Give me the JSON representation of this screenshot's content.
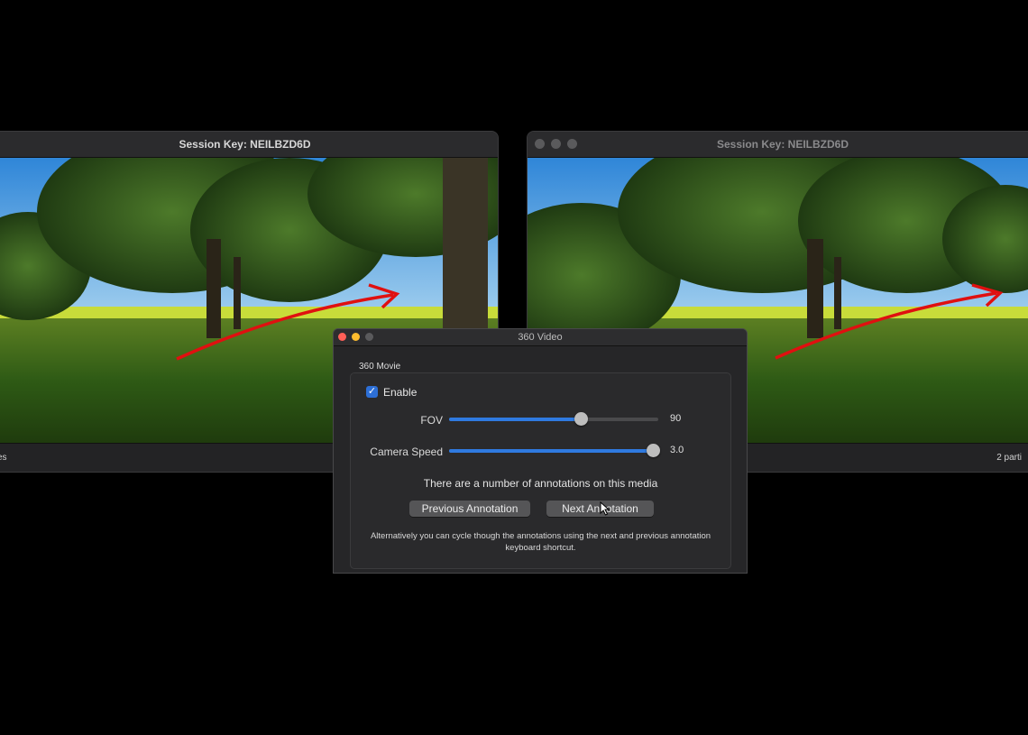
{
  "left_window": {
    "title": "Session Key: NEILBZD6D",
    "status_text": "es"
  },
  "right_window": {
    "title": "Session Key: NEILBZD6D",
    "status_text": "2 parti"
  },
  "dialog": {
    "title": "360 Video",
    "group_label": "360 Movie",
    "enable": {
      "label": "Enable",
      "checked": true
    },
    "fov": {
      "label": "FOV",
      "value": "90",
      "fraction": 0.63
    },
    "camera_speed": {
      "label": "Camera Speed",
      "value": "3.0",
      "fraction": 1.0
    },
    "annotation_info": "There are a number of annotations on this media",
    "previous_button": "Previous Annotation",
    "next_button": "Next Annotation",
    "note": "Alternatively you can cycle though the annotations using the next and previous annotation keyboard shortcut."
  },
  "colors": {
    "accent": "#2f7ae0",
    "annotation_arrow": "#e01010",
    "close": "#ff5f57",
    "minimize": "#febc2e"
  }
}
